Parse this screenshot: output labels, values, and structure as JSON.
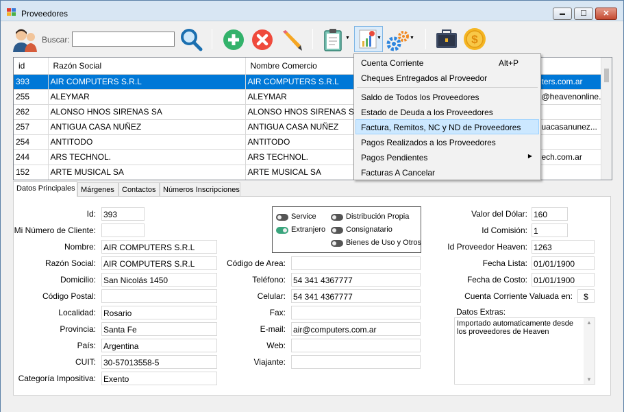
{
  "window": {
    "title": "Proveedores",
    "minimize": "▬",
    "maximize": "☐",
    "close": "✕"
  },
  "toolbar": {
    "search_label": "Buscar:",
    "search_value": ""
  },
  "grid": {
    "columns": [
      "id",
      "Razón Social",
      "Nombre Comercio",
      ""
    ],
    "rows": [
      [
        "393",
        "AIR COMPUTERS S.R.L",
        "AIR COMPUTERS S.R.L",
        "ters.com.ar"
      ],
      [
        "255",
        "ALEYMAR",
        "ALEYMAR",
        "@heavenonline..."
      ],
      [
        "262",
        "ALONSO HNOS SIRENAS SA",
        "ALONSO HNOS SIRENAS SA",
        ""
      ],
      [
        "257",
        "ANTIGUA CASA NUÑEZ",
        "ANTIGUA CASA NUÑEZ",
        "uacasanunez..."
      ],
      [
        "254",
        "ANTITODO",
        "ANTITODO",
        ""
      ],
      [
        "244",
        "ARS TECHNOL.",
        "ARS TECHNOL.",
        "ech.com.ar"
      ],
      [
        "152",
        "ARTE MUSICAL SA",
        "ARTE MUSICAL SA",
        ""
      ]
    ]
  },
  "menu": {
    "items": [
      {
        "label": "Cuenta Corriente",
        "shortcut": "Alt+P"
      },
      {
        "label": "Cheques Entregados al Proveedor"
      },
      {
        "label": "Saldo de Todos los Proveedores"
      },
      {
        "label": "Estado de Deuda a los Proveedores"
      },
      {
        "label": "Factura, Remitos, NC y ND de Proveedores"
      },
      {
        "label": "Pagos Realizados a los Proveedores"
      },
      {
        "label": "Pagos Pendientes"
      },
      {
        "label": "Facturas A Cancelar"
      }
    ]
  },
  "tabs": [
    "Datos Principales",
    "Márgenes",
    "Contactos",
    "Números Inscripciones"
  ],
  "form": {
    "id": {
      "label": "Id:",
      "value": "393"
    },
    "client_number": {
      "label": "Mi Número de Cliente:",
      "value": ""
    },
    "nombre": {
      "label": "Nombre:",
      "value": "AIR COMPUTERS S.R.L"
    },
    "razon_social": {
      "label": "Razón Social:",
      "value": "AIR COMPUTERS S.R.L"
    },
    "domicilio": {
      "label": "Domicilio:",
      "value": "San Nicolás 1450"
    },
    "codigo_postal": {
      "label": "Código Postal:",
      "value": ""
    },
    "localidad": {
      "label": "Localidad:",
      "value": "Rosario"
    },
    "provincia": {
      "label": "Provincia:",
      "value": "Santa Fe"
    },
    "pais": {
      "label": "País:",
      "value": "Argentina"
    },
    "cuit": {
      "label": "CUIT:",
      "value": "30-57013558-5"
    },
    "categoria": {
      "label": "Categoría Impositiva:",
      "value": "Exento"
    },
    "codigo_area": {
      "label": "Código de Area:",
      "value": ""
    },
    "telefono": {
      "label": "Teléfono:",
      "value": "54 341 4367777"
    },
    "celular": {
      "label": "Celular:",
      "value": "54 341 4367777"
    },
    "fax": {
      "label": "Fax:",
      "value": ""
    },
    "email": {
      "label": "E-mail:",
      "value": "air@computers.com.ar"
    },
    "web": {
      "label": "Web:",
      "value": ""
    },
    "viajante": {
      "label": "Viajante:",
      "value": ""
    },
    "valor_dolar": {
      "label": "Valor del Dólar:",
      "value": "160"
    },
    "id_comision": {
      "label": "Id Comisión:",
      "value": "1"
    },
    "id_heaven": {
      "label": "Id Proveedor Heaven:",
      "value": "1263"
    },
    "fecha_lista": {
      "label": "Fecha Lista:",
      "value": "01/01/1900"
    },
    "fecha_costo": {
      "label": "Fecha de Costo:",
      "value": "01/01/1900"
    },
    "cc_valuada": {
      "label": "Cuenta Corriente Valuada en:",
      "value": "$"
    },
    "datos_extras": {
      "label": "Datos Extras:",
      "value": "Importado automaticamente desde los proveedores de Heaven"
    }
  },
  "flags": {
    "service": {
      "label": "Service",
      "on": false
    },
    "extranjero": {
      "label": "Extranjero",
      "on": true
    },
    "distribucion": {
      "label": "Distribución Propia",
      "on": false
    },
    "consignatario": {
      "label": "Consignatario",
      "on": false
    },
    "bienes_uso": {
      "label": "Bienes de Uso y Otros",
      "on": false
    }
  },
  "colors": {
    "selection": "#0078d7",
    "menu_highlight": "#cce8ff",
    "toggle_on": "#3aa57d"
  }
}
